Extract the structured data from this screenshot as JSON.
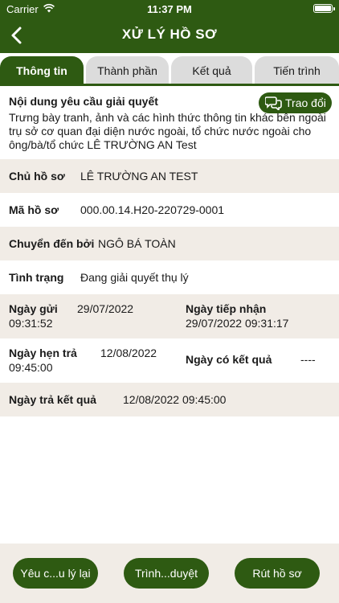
{
  "status_bar": {
    "carrier": "Carrier",
    "time": "11:37 PM"
  },
  "header": {
    "title": "XỬ LÝ HỒ SƠ"
  },
  "tabs": [
    {
      "label": "Thông tin",
      "active": true
    },
    {
      "label": "Thành phần",
      "active": false
    },
    {
      "label": "Kết quả",
      "active": false
    },
    {
      "label": "Tiến trình",
      "active": false
    }
  ],
  "request": {
    "heading": "Nội dung yêu cầu giải quyết",
    "body": "Trưng bày tranh, ảnh và các hình thức thông tin khác bên ngoài trụ sở cơ quan đại diện nước ngoài, tổ chức nước ngoài cho ông/bà/tổ chức LÊ TRƯỜNG AN Test",
    "chat_label": "Trao đổi"
  },
  "fields": {
    "owner": {
      "label": "Chủ hồ sơ",
      "value": "LÊ TRƯỜNG AN TEST"
    },
    "code": {
      "label": "Mã hồ sơ",
      "value": "000.00.14.H20-220729-0001"
    },
    "forwarded_by": {
      "label": "Chuyển đến bởi",
      "value": "NGÔ BÁ TOÀN"
    },
    "state": {
      "label": "Tình trạng",
      "value": "Đang giải quyết thụ lý"
    },
    "sent": {
      "label": "Ngày gửi",
      "date": "29/07/2022",
      "time": "09:31:52"
    },
    "received": {
      "label": "Ngày tiếp nhận",
      "value": "29/07/2022 09:31:17"
    },
    "appointment": {
      "label": "Ngày hẹn trả",
      "date": "12/08/2022",
      "time": "09:45:00"
    },
    "result_date": {
      "label": "Ngày có kết quả",
      "value": "----"
    },
    "returned": {
      "label": "Ngày trả kết quả",
      "value": "12/08/2022 09:45:00"
    }
  },
  "footer": {
    "request_reprocess": "Yêu c...u lý lại",
    "submit_approval": "Trình...duyệt",
    "withdraw": "Rút hồ sơ"
  },
  "colors": {
    "primary": "#2e5a12",
    "shade": "#f1ece6",
    "tab_inactive": "#dcdcdc"
  }
}
